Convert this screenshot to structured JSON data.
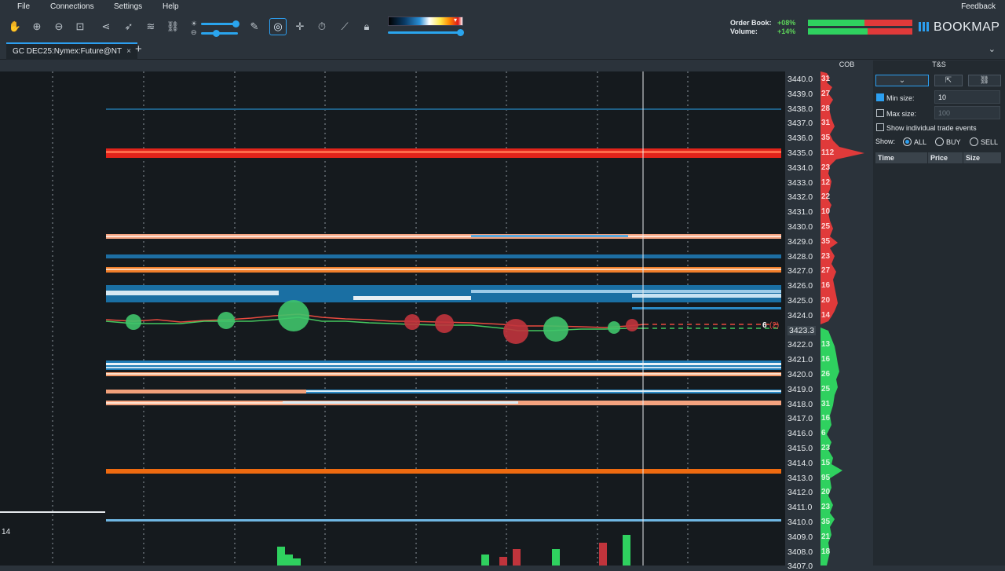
{
  "menu": {
    "items": [
      "File",
      "Connections",
      "Settings",
      "Help"
    ],
    "feedback": "Feedback"
  },
  "toolbar": {
    "icons": [
      "hand-icon",
      "zoom-in-icon",
      "zoom-out-icon",
      "zoom-fit-icon",
      "share-icon",
      "rocket-icon",
      "layers-icon",
      "link-icon",
      "pencil-icon",
      "chat-bubble-icon",
      "crosshair-icon",
      "timer-icon",
      "line-chart-icon",
      "lock-icon"
    ],
    "active_icon": "chat-bubble-icon"
  },
  "orderbook": {
    "order_book_label": "Order Book:",
    "order_book_value": "+08%",
    "volume_label": "Volume:",
    "volume_value": "+14%",
    "bid_color": "#2fd15f",
    "ask_color": "#e03a3a"
  },
  "brand": {
    "logo": "BOOKMAP"
  },
  "tabs": {
    "active": "GC DEC25:Nymex:Future@NT",
    "close": "×",
    "add": "+"
  },
  "price_axis": {
    "labels": [
      "3440.0",
      "3439.0",
      "3438.0",
      "3437.0",
      "3436.0",
      "3435.0",
      "3434.0",
      "3433.0",
      "3432.0",
      "3431.0",
      "3430.0",
      "3429.0",
      "3428.0",
      "3427.0",
      "3426.0",
      "3425.0",
      "3424.0",
      "3423.3",
      "3422.0",
      "3421.0",
      "3420.0",
      "3419.0",
      "3418.0",
      "3417.0",
      "3416.0",
      "3415.0",
      "3414.0",
      "3413.0",
      "3412.0",
      "3411.0",
      "3410.0",
      "3409.0",
      "3408.0",
      "3407.0"
    ],
    "current_price": "3423.3",
    "last_trade": "6",
    "last_trade_extra": "(2)"
  },
  "cob": {
    "header": "COB",
    "ask_sizes": [
      "31",
      "27",
      "28",
      "31",
      "35",
      "112",
      "23",
      "12",
      "22",
      "10",
      "25",
      "35",
      "23",
      "27",
      "16",
      "20",
      "14"
    ],
    "bid_sizes": [
      "13",
      "16",
      "26",
      "25",
      "31",
      "16",
      "6",
      "23",
      "15",
      "95",
      "20",
      "23",
      "35",
      "21",
      "18"
    ]
  },
  "volume_axis_label": "14",
  "ts": {
    "header": "T&S",
    "min_size_label": "Min size:",
    "min_size_value": "10",
    "max_size_label": "Max size:",
    "max_size_placeholder": "100",
    "show_individual": "Show individual trade events",
    "show_label": "Show:",
    "show_options": [
      "ALL",
      "BUY",
      "SELL"
    ],
    "columns": [
      "Time",
      "Price",
      "Size"
    ]
  }
}
